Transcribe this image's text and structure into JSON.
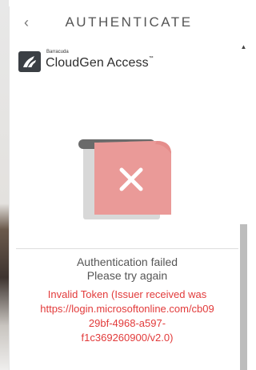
{
  "header": {
    "back_icon": "chevron-left-icon",
    "title": "AUTHENTICATE"
  },
  "brand": {
    "small_label": "Barracuda",
    "product_name": "CloudGen Access",
    "trademark": "™"
  },
  "illustration": {
    "icon": "close-icon",
    "card_color": "#ea9a98",
    "shadow_color": "#d5d5d5",
    "bar_color": "#6a6a6a"
  },
  "status": {
    "title": "Authentication failed",
    "subtitle": "Please try again",
    "error_lines": [
      "Invalid Token (Issuer received was",
      "https://login.microsoftonline.com/cb09",
      "29bf-4968-a597-",
      "f1c369260900/v2.0)"
    ],
    "error_color": "#e23b3b"
  }
}
